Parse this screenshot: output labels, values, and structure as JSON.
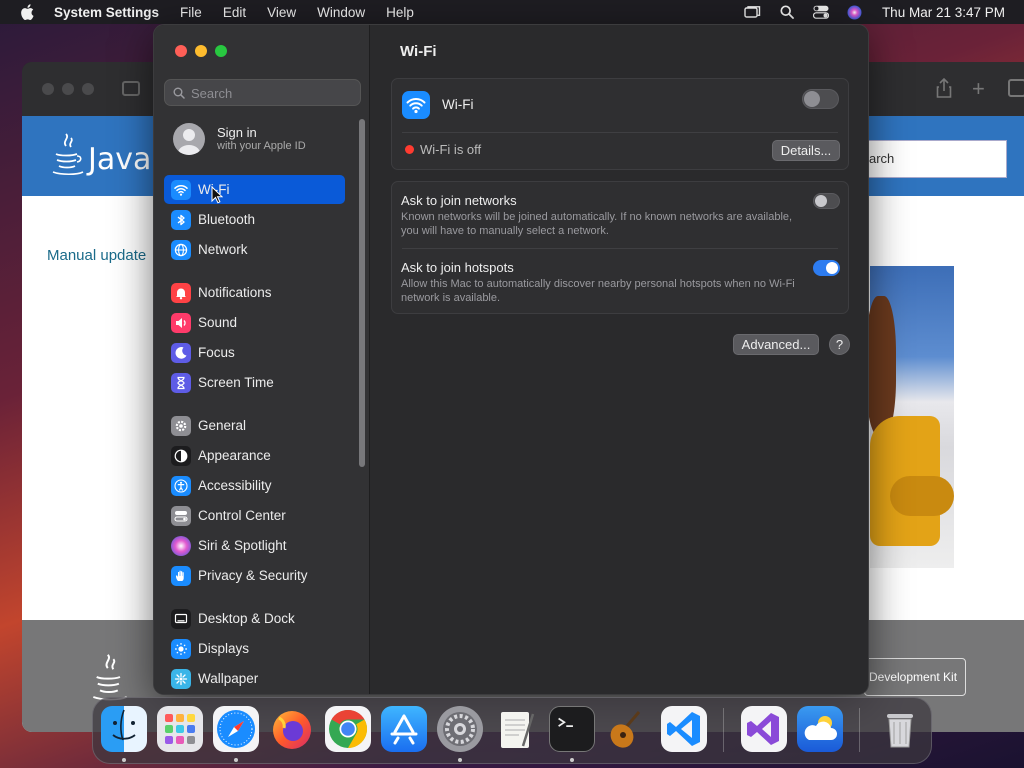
{
  "menubar": {
    "app_name": "System Settings",
    "menus": [
      "File",
      "Edit",
      "View",
      "Window",
      "Help"
    ],
    "clock": "Thu Mar 21  3:47 PM"
  },
  "background_window": {
    "logo_text": "Java",
    "search_text": "arch",
    "link_text": "Manual update",
    "button_text": "Development Kit"
  },
  "settings": {
    "search": {
      "placeholder": "Search"
    },
    "apple_id": {
      "title": "Sign in",
      "subtitle": "with your Apple ID"
    },
    "sidebar": {
      "items": [
        {
          "label": "Wi-Fi",
          "icon": "wifi-icon",
          "color": "#1a8cff"
        },
        {
          "label": "Bluetooth",
          "icon": "bluetooth-icon",
          "color": "#1a8cff"
        },
        {
          "label": "Network",
          "icon": "globe-icon",
          "color": "#1a8cff"
        },
        {
          "label": "Notifications",
          "icon": "bell-icon",
          "color": "#ff4245"
        },
        {
          "label": "Sound",
          "icon": "speaker-icon",
          "color": "#ff3b6a"
        },
        {
          "label": "Focus",
          "icon": "moon-icon",
          "color": "#5e5ce6"
        },
        {
          "label": "Screen Time",
          "icon": "hourglass-icon",
          "color": "#5e5ce6"
        },
        {
          "label": "General",
          "icon": "gear-icon",
          "color": "#8e8e93"
        },
        {
          "label": "Appearance",
          "icon": "appearance-icon",
          "color": "#1c1c1e"
        },
        {
          "label": "Accessibility",
          "icon": "accessibility-icon",
          "color": "#1a8cff"
        },
        {
          "label": "Control Center",
          "icon": "control-center-icon",
          "color": "#8e8e93"
        },
        {
          "label": "Siri & Spotlight",
          "icon": "siri-icon",
          "color": "#b34bd6"
        },
        {
          "label": "Privacy & Security",
          "icon": "hand-icon",
          "color": "#1a8cff"
        },
        {
          "label": "Desktop & Dock",
          "icon": "desktop-icon",
          "color": "#1c1c1e"
        },
        {
          "label": "Displays",
          "icon": "sun-icon",
          "color": "#1a8cff"
        },
        {
          "label": "Wallpaper",
          "icon": "wallpaper-icon",
          "color": "#3ab5e8"
        }
      ],
      "selected": "Wi-Fi"
    },
    "main": {
      "title": "Wi-Fi",
      "wifi_row_label": "Wi-Fi",
      "wifi_enabled": false,
      "status_text": "Wi-Fi is off",
      "status_color": "#ff3b30",
      "details_button": "Details...",
      "ask_networks": {
        "title": "Ask to join networks",
        "description": "Known networks will be joined automatically. If no known networks are available, you will have to manually select a network.",
        "enabled": false
      },
      "ask_hotspots": {
        "title": "Ask to join hotspots",
        "description": "Allow this Mac to automatically discover nearby personal hotspots when no Wi-Fi network is available.",
        "enabled": true
      },
      "advanced_button": "Advanced...",
      "help_button": "?"
    }
  },
  "dock": {
    "apps": [
      "Finder",
      "Launchpad",
      "Safari",
      "Firefox",
      "Chrome",
      "App Store",
      "System Settings",
      "TextEdit",
      "Terminal",
      "GarageBand",
      "Visual Studio Code",
      "Visual Studio",
      "Weather",
      "Trash"
    ]
  }
}
